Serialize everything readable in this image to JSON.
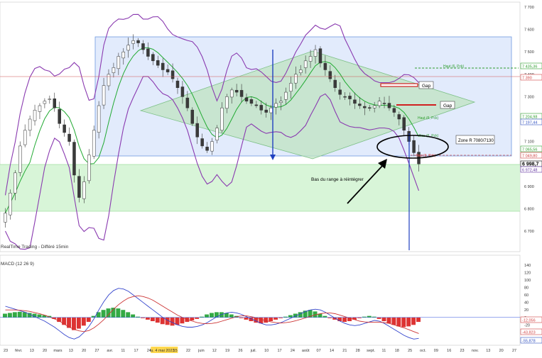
{
  "chart_data": [
    {
      "type": "candlestick",
      "title": "RealTime Trading - Différé 15min",
      "ylim": [
        6600,
        7700
      ],
      "y_ticks": [
        "7 700",
        "7 600",
        "7 500",
        "7 400",
        "7 300",
        "7 200",
        "7 100",
        "7 000",
        "6 900",
        "6 800",
        "6 700"
      ],
      "x_ticks": [
        "23",
        "févr.",
        "13",
        "20",
        "mars",
        "13",
        "20",
        "27",
        "avr.",
        "11",
        "17",
        "24",
        "lu. 4 mai 2023",
        "15",
        "22",
        "juin",
        "12",
        "19",
        "26",
        "juil.",
        "10",
        "17",
        "24",
        "août",
        "07",
        "14",
        "21",
        "28",
        "sept.",
        "11",
        "18",
        "25",
        "oct.",
        "09",
        "16",
        "23",
        "nov.",
        "13",
        "20",
        "27"
      ],
      "price_labels": [
        {
          "text": "7 435,36",
          "color": "#2e9e2e"
        },
        {
          "text": "7 390",
          "color": "#d04040"
        },
        {
          "text": "7 204,98",
          "color": "#2e9e2e"
        },
        {
          "text": "7 197,44",
          "color": "#3050c0"
        },
        {
          "text": "7 065,56",
          "color": "#2e9e2e"
        },
        {
          "text": "7 049,80",
          "color": "#d04040"
        },
        {
          "text": "6 998,7",
          "color": "#000000"
        },
        {
          "text": "6 972,48",
          "color": "#6030a0"
        }
      ],
      "annotations": [
        {
          "text": "Gap"
        },
        {
          "text": "Gap"
        },
        {
          "text": "Zone R 7080/7130"
        },
        {
          "text": "Bas du range à réintégrer"
        },
        {
          "text": "Haut (6, Pck)"
        },
        {
          "text": "Haut (6, Pck)"
        },
        {
          "text": "Bas (6, Pck)"
        },
        {
          "text": "Bas (6, Pck)"
        }
      ],
      "zones": [
        {
          "name": "Zone R 7080/7130",
          "from": 7080,
          "to": 7580,
          "color": "#dbe6fb"
        },
        {
          "name": "support range",
          "from": 6800,
          "to": 7000,
          "color": "#d4f4d4"
        }
      ],
      "horizontal_lines": [
        {
          "value": 7390,
          "color": "#d05050"
        },
        {
          "value": 7435,
          "color": "#2e9e2e"
        },
        {
          "value": 7049,
          "color": "#d05050"
        }
      ],
      "series": [
        {
          "name": "Close",
          "values": [
            6780,
            6870,
            6960,
            7080,
            7150,
            7200,
            7240,
            7260,
            7280,
            7290,
            7250,
            7180,
            7140,
            7100,
            6950,
            6850,
            6920,
            7040,
            7150,
            7260,
            7350,
            7400,
            7430,
            7480,
            7500,
            7530,
            7550,
            7540,
            7510,
            7480,
            7460,
            7440,
            7420,
            7410,
            7380,
            7340,
            7300,
            7250,
            7180,
            7120,
            7080,
            7060,
            7100,
            7160,
            7250,
            7300,
            7330,
            7320,
            7300,
            7280,
            7270,
            7260,
            7240,
            7230,
            7250,
            7270,
            7280,
            7320,
            7360,
            7400,
            7420,
            7460,
            7480,
            7510,
            7450,
            7420,
            7380,
            7340,
            7310,
            7300,
            7290,
            7270,
            7260,
            7250,
            7250,
            7260,
            7280,
            7270,
            7250,
            7230,
            7200,
            7150,
            7100,
            7050,
            7000
          ]
        },
        {
          "name": "Upper band"
        },
        {
          "name": "Lower band"
        },
        {
          "name": "Moving average"
        }
      ]
    },
    {
      "type": "macd",
      "title": "MACD (12 26 9)",
      "ylim": [
        -65,
        140
      ],
      "y_ticks": [
        "140",
        "120",
        "100",
        "80",
        "60",
        "40",
        "20",
        "0",
        "-20",
        "-40",
        "-60"
      ],
      "value_labels": [
        {
          "text": "-12,056",
          "color": "#d04040"
        },
        {
          "text": "-43,823",
          "color": "#d04040"
        },
        {
          "text": "-55,878",
          "color": "#3050c0"
        }
      ],
      "series": [
        {
          "name": "Histogram",
          "values": [
            10,
            12,
            14,
            15,
            14,
            12,
            10,
            8,
            6,
            4,
            -4,
            -12,
            -20,
            -28,
            -34,
            -30,
            -22,
            -12,
            4,
            14,
            20,
            24,
            26,
            24,
            20,
            14,
            8,
            2,
            -2,
            -6,
            -10,
            -14,
            -18,
            -20,
            -22,
            -20,
            -16,
            -12,
            -8,
            -4,
            2,
            8,
            12,
            14,
            14,
            12,
            8,
            4,
            -2,
            -6,
            -10,
            -14,
            -16,
            -14,
            -10,
            -6,
            -2,
            2,
            6,
            10,
            14,
            18,
            20,
            16,
            10,
            4,
            -2,
            -6,
            -10,
            -12,
            -10,
            -6,
            -2,
            2,
            4,
            2,
            -4,
            -10,
            -16,
            -20,
            -24,
            -26,
            -24,
            -20,
            -12
          ]
        },
        {
          "name": "MACD",
          "values": [
            30,
            26,
            22,
            18,
            14,
            8,
            2,
            -4,
            -10,
            -18,
            -26,
            -36,
            -46,
            -54,
            -58,
            -52,
            -40,
            -24,
            -4,
            20,
            42,
            60,
            72,
            78,
            76,
            70,
            60,
            50,
            40,
            30,
            20,
            10,
            0,
            -8,
            -14,
            -20,
            -24,
            -26,
            -26,
            -24,
            -20,
            -14,
            -6,
            2,
            8,
            12,
            14,
            12,
            8,
            2,
            -4,
            -10,
            -16,
            -20,
            -20,
            -18,
            -14,
            -8,
            -2,
            4,
            10,
            16,
            20,
            22,
            20,
            14,
            6,
            -2,
            -10,
            -16,
            -20,
            -22,
            -20,
            -16,
            -12,
            -8,
            -10,
            -16,
            -24,
            -32,
            -40,
            -48,
            -54,
            -58,
            -56
          ]
        },
        {
          "name": "Signal",
          "values": [
            20,
            20,
            20,
            19,
            18,
            16,
            13,
            10,
            6,
            1,
            -4,
            -10,
            -18,
            -26,
            -32,
            -36,
            -38,
            -35,
            -28,
            -18,
            -6,
            8,
            22,
            34,
            44,
            52,
            56,
            58,
            56,
            52,
            46,
            38,
            30,
            22,
            14,
            6,
            0,
            -6,
            -10,
            -14,
            -16,
            -17,
            -16,
            -14,
            -10,
            -6,
            -2,
            2,
            4,
            4,
            2,
            -1,
            -5,
            -9,
            -12,
            -14,
            -15,
            -14,
            -12,
            -9,
            -5,
            -1,
            3,
            7,
            10,
            12,
            12,
            10,
            6,
            2,
            -2,
            -6,
            -10,
            -12,
            -13,
            -13,
            -13,
            -14,
            -16,
            -20,
            -24,
            -28,
            -33,
            -38,
            -43
          ]
        }
      ]
    }
  ]
}
